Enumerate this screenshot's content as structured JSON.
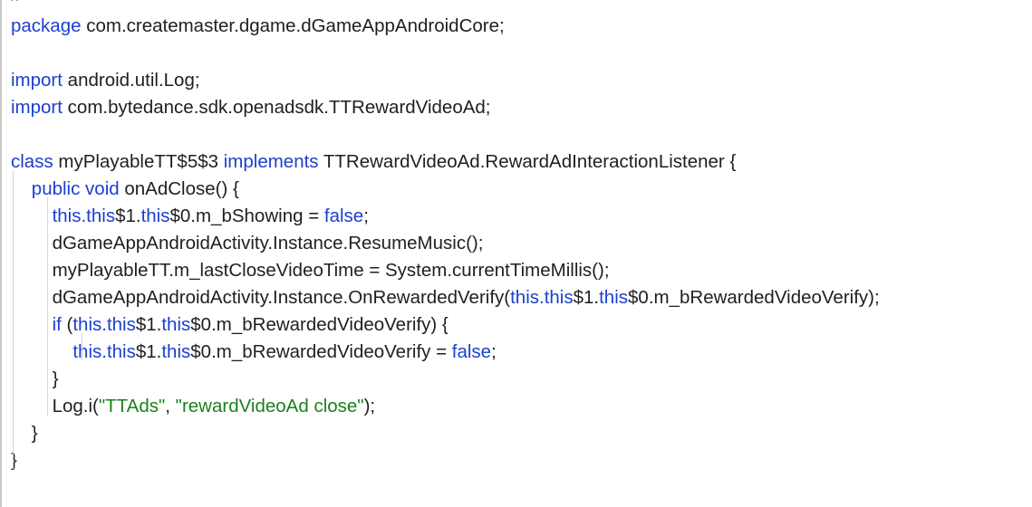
{
  "editor": {
    "top_comment": "//",
    "lines": [
      {
        "tokens": [
          {
            "t": "package",
            "k": "kw"
          },
          {
            "t": " com.createmaster.dgame.dGameAppAndroidCore;",
            "k": "plain"
          }
        ]
      },
      {
        "tokens": []
      },
      {
        "tokens": [
          {
            "t": "import",
            "k": "kw"
          },
          {
            "t": " android.util.Log;",
            "k": "plain"
          }
        ]
      },
      {
        "tokens": [
          {
            "t": "import",
            "k": "kw"
          },
          {
            "t": " com.bytedance.sdk.openadsdk.TTRewardVideoAd;",
            "k": "plain"
          }
        ]
      },
      {
        "tokens": []
      },
      {
        "tokens": [
          {
            "t": "class",
            "k": "kw"
          },
          {
            "t": " myPlayableTT$5$3 ",
            "k": "plain"
          },
          {
            "t": "implements",
            "k": "kw"
          },
          {
            "t": " TTRewardVideoAd.RewardAdInteractionListener {",
            "k": "plain"
          }
        ]
      },
      {
        "tokens": [
          {
            "t": "    ",
            "k": "plain"
          },
          {
            "t": "public void",
            "k": "kw"
          },
          {
            "t": " onAdClose() {",
            "k": "plain"
          }
        ]
      },
      {
        "tokens": [
          {
            "t": "        ",
            "k": "plain"
          },
          {
            "t": "this.this",
            "k": "kw"
          },
          {
            "t": "$1.",
            "k": "plain"
          },
          {
            "t": "this",
            "k": "kw"
          },
          {
            "t": "$0.m_bShowing = ",
            "k": "plain"
          },
          {
            "t": "false",
            "k": "kw"
          },
          {
            "t": ";",
            "k": "plain"
          }
        ]
      },
      {
        "tokens": [
          {
            "t": "        dGameAppAndroidActivity.Instance.ResumeMusic();",
            "k": "plain"
          }
        ]
      },
      {
        "tokens": [
          {
            "t": "        myPlayableTT.m_lastCloseVideoTime = System.currentTimeMillis();",
            "k": "plain"
          }
        ]
      },
      {
        "tokens": [
          {
            "t": "        dGameAppAndroidActivity.Instance.OnRewardedVerify(",
            "k": "plain"
          },
          {
            "t": "this.this",
            "k": "kw"
          },
          {
            "t": "$1.",
            "k": "plain"
          },
          {
            "t": "this",
            "k": "kw"
          },
          {
            "t": "$0.m_bRewardedVideoVerify);",
            "k": "plain"
          }
        ]
      },
      {
        "tokens": [
          {
            "t": "        ",
            "k": "plain"
          },
          {
            "t": "if",
            "k": "kw"
          },
          {
            "t": " (",
            "k": "plain"
          },
          {
            "t": "this.this",
            "k": "kw"
          },
          {
            "t": "$1.",
            "k": "plain"
          },
          {
            "t": "this",
            "k": "kw"
          },
          {
            "t": "$0.m_bRewardedVideoVerify) {",
            "k": "plain"
          }
        ]
      },
      {
        "tokens": [
          {
            "t": "            ",
            "k": "plain"
          },
          {
            "t": "this.this",
            "k": "kw"
          },
          {
            "t": "$1.",
            "k": "plain"
          },
          {
            "t": "this",
            "k": "kw"
          },
          {
            "t": "$0.m_bRewardedVideoVerify = ",
            "k": "plain"
          },
          {
            "t": "false",
            "k": "kw"
          },
          {
            "t": ";",
            "k": "plain"
          }
        ]
      },
      {
        "tokens": [
          {
            "t": "        }",
            "k": "plain"
          }
        ]
      },
      {
        "tokens": [
          {
            "t": "        Log.i(",
            "k": "plain"
          },
          {
            "t": "\"TTAds\"",
            "k": "str"
          },
          {
            "t": ", ",
            "k": "plain"
          },
          {
            "t": "\"rewardVideoAd close\"",
            "k": "str"
          },
          {
            "t": ");",
            "k": "plain"
          }
        ]
      },
      {
        "tokens": [
          {
            "t": "    }",
            "k": "plain"
          }
        ]
      },
      {
        "tokens": [
          {
            "t": "}",
            "k": "plain"
          }
        ]
      }
    ]
  },
  "colors": {
    "keyword": "#1c3fd0",
    "string": "#1d7f1d",
    "text": "#1f1f1f",
    "indent_guide": "#d6d6d6",
    "background": "#ffffff"
  }
}
